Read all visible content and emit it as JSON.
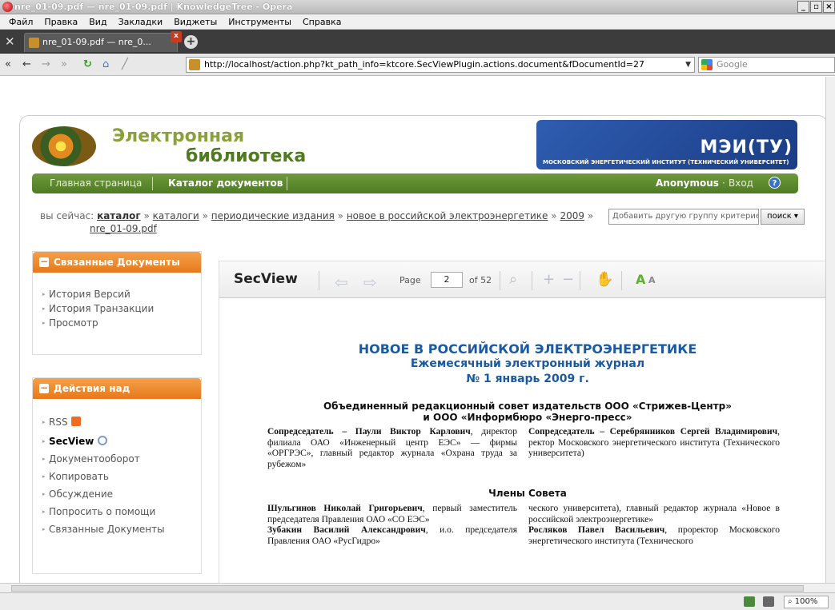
{
  "window": {
    "title": "nre_01-09.pdf — nre_01-09.pdf | KnowledgeTree - Opera",
    "controls": [
      "_",
      "▫",
      "×"
    ]
  },
  "menu": [
    "Файл",
    "Правка",
    "Вид",
    "Закладки",
    "Виджеты",
    "Инструменты",
    "Справка"
  ],
  "tab": {
    "label": "nre_01-09.pdf — nre_0..."
  },
  "address": {
    "url": "http://localhost/action.php?kt_path_info=ktcore.SecViewPlugin.actions.document&fDocumentId=27",
    "search_placeholder": "Google"
  },
  "site": {
    "brand_line1": "Электронная",
    "brand_line2": "библиотека",
    "mei_big": "МЭИ(ТУ)",
    "mei_small": "МОСКОВСКИЙ ЭНЕРГЕТИЧЕСКИЙ ИНСТИТУТ (ТЕХНИЧЕСКИЙ УНИВЕРСИТЕТ)"
  },
  "nav": {
    "home": "Главная страница",
    "catalog": "Каталог документов",
    "user": "Anonymous",
    "login_sep": " · ",
    "login": "Вход",
    "help": "?"
  },
  "breadcrumb": {
    "prefix": "вы сейчас:",
    "items": [
      "каталог",
      "каталоги",
      "периодические издания",
      "новое в российской электроэнергетике",
      "2009"
    ],
    "separator": "»",
    "last": "nre_01-09.pdf",
    "criteria_placeholder": "Добавить другую группу критериев",
    "search_button": "поиск ▾"
  },
  "related": {
    "title": "Связанные Документы",
    "items": [
      "История Версий",
      "История Транзакции",
      "Просмотр"
    ]
  },
  "actions": {
    "title": "Действия над документом",
    "items": [
      "RSS",
      "SecView",
      "Документооборот",
      "Копировать",
      "Обсуждение",
      "Попросить о помощи",
      "Связанные Документы"
    ]
  },
  "viewer": {
    "title": "SecView",
    "page_label": "Page",
    "page": "2",
    "of_label": "of 52"
  },
  "document": {
    "h1": "НОВОЕ В РОССИЙСКОЙ ЭЛЕКТРОЭНЕРГЕТИКЕ",
    "h2a": "Ежемесячный электронный журнал",
    "h2b": "№ 1 январь 2009 г.",
    "board1": "Объединенный редакционный совет издательств ООО «Стрижев-Центр»",
    "board2": "и ООО «Информбюро «Энерго-пресс»",
    "c1_bold": "Сопредседатель – Паули Виктор Карлович",
    "c1_rest": ", директор филиала ОАО «Инженерный центр ЕЭС» — фирмы «ОРГРЭС», главный редактор журнала «Охрана труда за рубежом»",
    "c2_bold": "Сопредседатель – Серебрянников Сергей Владимирович",
    "c2_rest": ", ректор Московского энергетического института (Технического университета)",
    "members": "Члены Совета",
    "m1_bold": "Шульгинов Николай Григорьевич",
    "m1_rest": ", первый заместитель председателя Правления ОАО «СО ЕЭС»",
    "m2_bold": "Зубакин Василий Александрович",
    "m2_rest": ", и.о. председателя Правления ОАО «РусГидро»",
    "m3_text": "ческого университета), главный редактор журнала «Новое в российской электроэнергетике»",
    "m4_bold": "Росляков Павел Васильевич",
    "m4_rest": ", проректор Московского энергетического института (Технического"
  },
  "status": {
    "zoom": "100%"
  }
}
